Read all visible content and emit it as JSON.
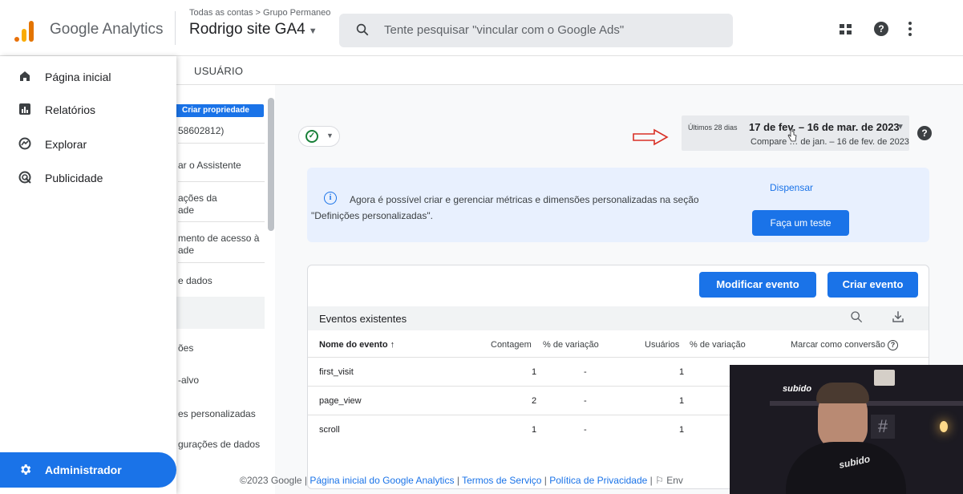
{
  "header": {
    "app_title": "Google Analytics",
    "breadcrumb": "Todas as contas > Grupo Permaneo",
    "property_name": "Rodrigo site GA4",
    "search_placeholder": "Tente pesquisar \"vincular com o Google Ads\""
  },
  "nav": {
    "items": [
      {
        "label": "Página inicial",
        "icon": "home-icon"
      },
      {
        "label": "Relatórios",
        "icon": "reports-icon"
      },
      {
        "label": "Explorar",
        "icon": "explore-icon"
      },
      {
        "label": "Publicidade",
        "icon": "advertising-icon"
      }
    ],
    "admin_label": "Administrador"
  },
  "admin_column": {
    "tab": "USUÁRIO",
    "create_property": "Criar propriedade",
    "property_id": "58602812)",
    "items": [
      "ar o Assistente",
      "ações da\nade",
      "mento de acesso à\nade",
      "e dados",
      "ões",
      "-alvo",
      "es personalizadas",
      "gurações de dados"
    ]
  },
  "date": {
    "label": "Últimos 28 dias",
    "range": "17 de fev. – 16 de mar. de 2023",
    "compare": "Compare … de jan. – 16 de fev. de 2023"
  },
  "banner": {
    "text": "Agora é possível criar e gerenciar métricas e dimensões personalizadas na seção \"Definições personalizadas\".",
    "dismiss": "Dispensar",
    "try_button": "Faça um teste"
  },
  "events": {
    "modify_button": "Modificar evento",
    "create_button": "Criar evento",
    "title": "Eventos existentes",
    "columns": {
      "name": "Nome do evento ↑",
      "count": "Contagem",
      "change1": "% de variação",
      "users": "Usuários",
      "change2": "% de variação",
      "conversion": "Marcar como conversão"
    },
    "rows": [
      {
        "name": "first_visit",
        "count": "1",
        "change1": "-",
        "users": "1"
      },
      {
        "name": "page_view",
        "count": "2",
        "change1": "-",
        "users": "1"
      },
      {
        "name": "scroll",
        "count": "1",
        "change1": "-",
        "users": "1"
      }
    ]
  },
  "footer": {
    "copyright": "©2023 Google | ",
    "link1": "Página inicial do Google Analytics",
    "sep1": " | ",
    "link2": "Termos de Serviço",
    "sep2": " | ",
    "link3": "Política de Privacidade",
    "sep3": " | ",
    "feedback": "⚐ Env"
  },
  "webcam": {
    "sign": "subido",
    "shirt": "subido"
  },
  "colors": {
    "primary": "#1a73e8",
    "banner_bg": "#e8f0fe",
    "arrow": "#d93025"
  }
}
